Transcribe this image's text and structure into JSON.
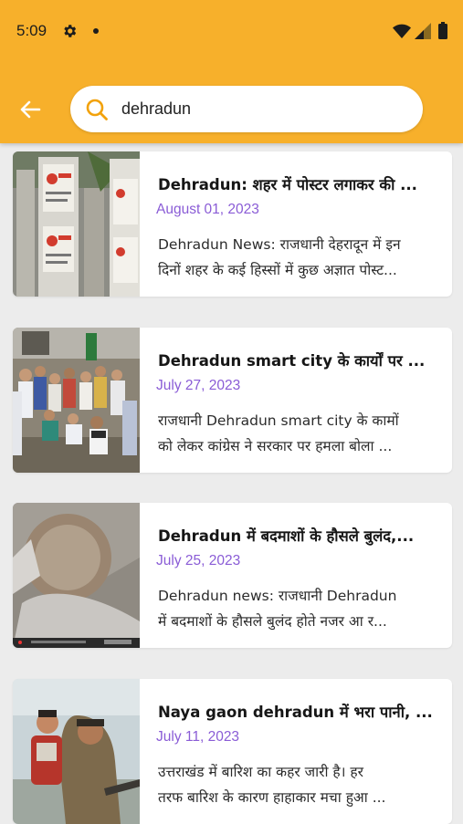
{
  "status_bar": {
    "time": "5:09",
    "icons": [
      "gear-icon",
      "notification-dot-icon",
      "wifi-icon",
      "signal-icon",
      "battery-icon"
    ]
  },
  "header": {
    "back_icon": "back-arrow-icon",
    "search_icon": "search-icon",
    "search_value": "dehradun",
    "accent_color": "#f7b02b"
  },
  "results": [
    {
      "title": "Dehradun: शहर में पोस्टर लगाकर की ...",
      "date": "August 01, 2023",
      "desc_line1": "Dehradun News: राजधानी देहरादून में इन",
      "desc_line2": "दिनों शहर के कई हिस्सों में कुछ अज्ञात पोस्ट..."
    },
    {
      "title": "Dehradun smart city के कार्यों पर ...",
      "date": "July 27, 2023",
      "desc_line1": "राजधानी Dehradun smart city के कामों",
      "desc_line2": "को लेकर कांग्रेस ने सरकार पर हमला बोला ..."
    },
    {
      "title": "Dehradun में बदमाशों के हौसले बुलंद,...",
      "date": "July 25, 2023",
      "desc_line1": "Dehradun news: राजधानी Dehradun",
      "desc_line2": "में बदमाशों के हौसले बुलंद होते नजर आ र..."
    },
    {
      "title": "Naya gaon dehradun में भरा पानी, ...",
      "date": "July 11, 2023",
      "desc_line1": "उत्तराखंड में बारिश का कहर जारी है। हर",
      "desc_line2": "तरफ बारिश के कारण हाहाकार मचा हुआ ..."
    }
  ],
  "date_color": "#8a5cd6"
}
